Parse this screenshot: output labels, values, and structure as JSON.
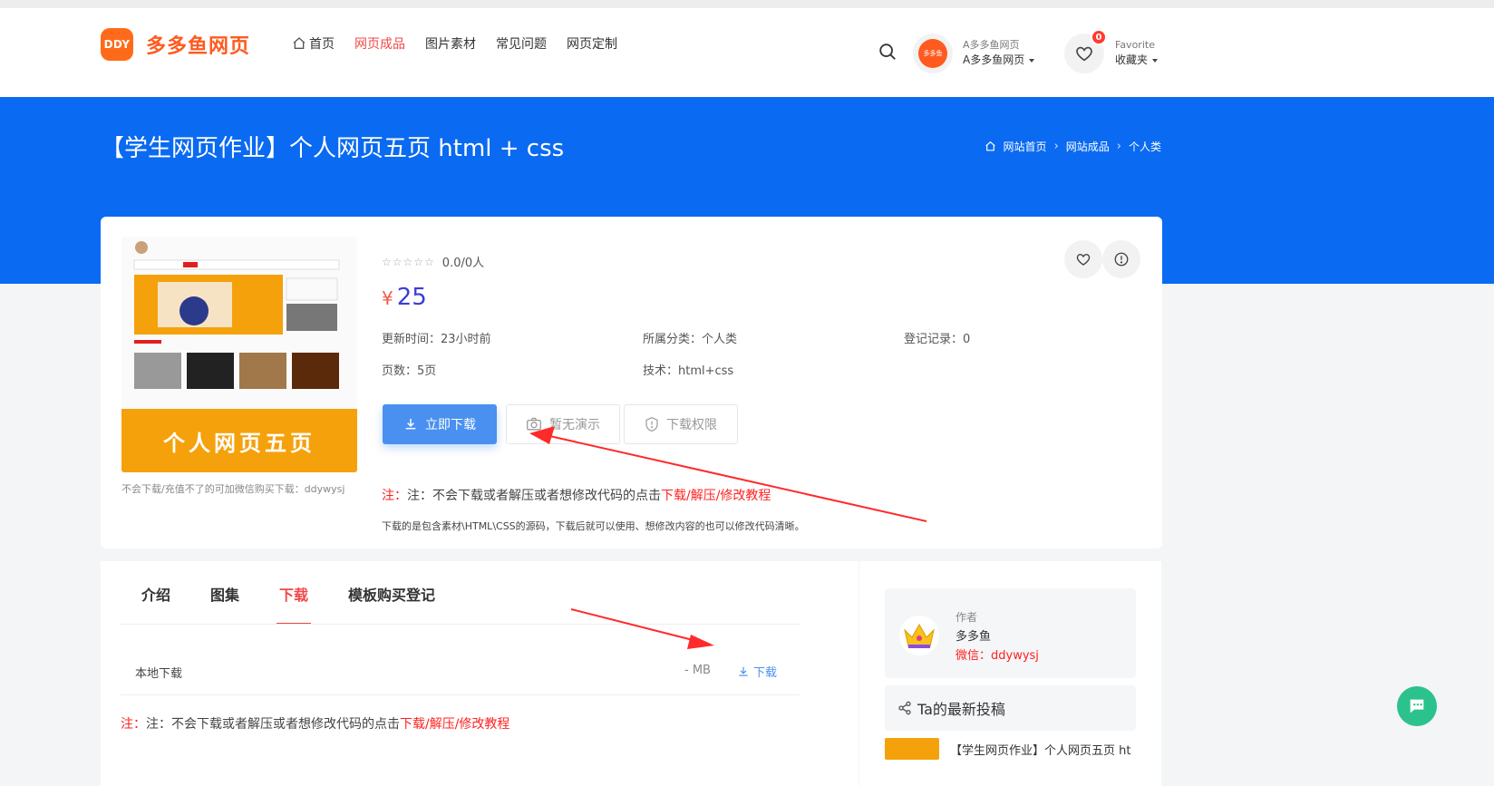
{
  "header": {
    "logo_badge": "DDY",
    "logo_text": "多多鱼网页",
    "nav": [
      {
        "label": "首页",
        "icon": "home-icon"
      },
      {
        "label": "网页成品",
        "active": true
      },
      {
        "label": "图片素材"
      },
      {
        "label": "常见问题"
      },
      {
        "label": "网页定制"
      }
    ],
    "user": {
      "avatar_text": "多多鱼",
      "line1": "A多多鱼网页",
      "line2": "A多多鱼网页"
    },
    "favorite": {
      "count": "0",
      "line1": "Favorite",
      "line2": "收藏夹"
    }
  },
  "banner": {
    "title": "【学生网页作业】个人网页五页 html + css",
    "breadcrumb": [
      "网站首页",
      "网站成品",
      "个人类"
    ]
  },
  "product": {
    "thumbnail_title": "个人网页五页",
    "thumb_note": "不会下载/充值不了的可加微信购买下载：ddywysj",
    "rating": "0.0/0人",
    "price_symbol": "¥",
    "price": "25",
    "meta": {
      "updated": "更新时间：23小时前",
      "category": "所属分类：个人类",
      "records": "登记记录：0",
      "pages": "页数：5页",
      "tech": "技术：html+css"
    },
    "buttons": {
      "download": "立即下载",
      "demo": "暂无演示",
      "permission": "下载权限"
    },
    "note_prefix": "注：不会下载或者解压或者想修改代码的点击",
    "note_link": "下载/解压/修改教程",
    "note_small": "下载的是包含素材\\HTML\\CSS的源码，下载后就可以使用、想修改内容的也可以修改代码清晰。"
  },
  "tabs": {
    "items": [
      "介绍",
      "图集",
      "下载",
      "模板购买登记"
    ],
    "active": "下载",
    "download_row": {
      "label": "本地下载",
      "size": "- MB",
      "link": "下载"
    },
    "note_prefix": "注：不会下载或者解压或者想修改代码的点击",
    "note_link": "下载/解压/修改教程"
  },
  "sidebar": {
    "author_label": "作者",
    "author_name": "多多鱼",
    "author_wechat": "微信：ddywysj",
    "posts_title": "Ta的最新投稿",
    "post_title": "【学生网页作业】个人网页五页 ht"
  },
  "colors": {
    "accent": "#0a6af2",
    "red": "#ff2121",
    "logo": "#ff5a1f"
  }
}
